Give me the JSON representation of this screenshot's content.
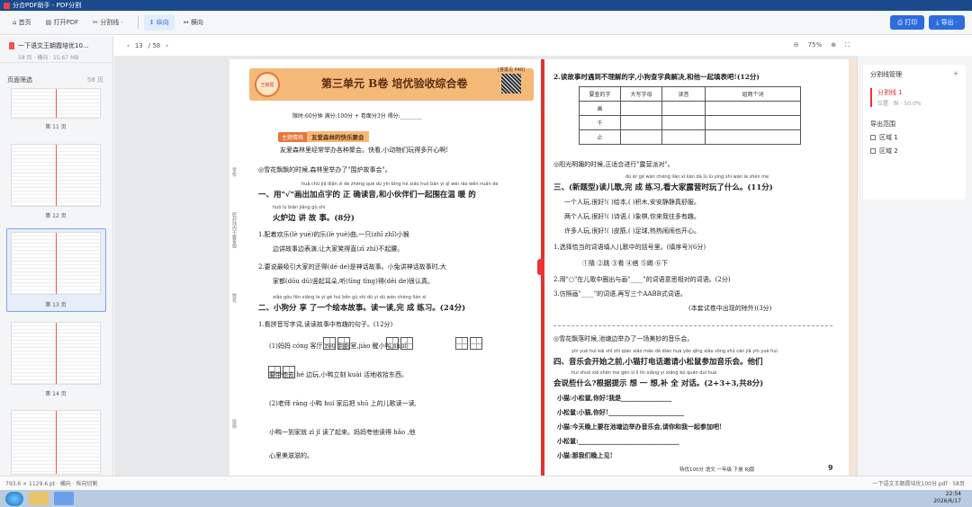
{
  "window": {
    "title": "分合PDF助手 - PDF分割"
  },
  "toolbar": {
    "home": "首页",
    "open_pdf": "打开PDF",
    "split_mode": "分割线 ·",
    "vertical": "纵向",
    "horizontal": "横向",
    "print": "打印",
    "export": "导出 ·"
  },
  "sidebar": {
    "file_name": "一下语文王朝霞培优10...",
    "file_meta": "58 页 · 横向 · 15.67 MB",
    "pages_title": "页面筛选",
    "pages_count": "58 页",
    "thumbs": [
      "第 11 页",
      "第 12 页",
      "第 13 页",
      "第 14 页",
      "第 15 页"
    ]
  },
  "pagebar": {
    "current": "13",
    "total": "/ 58",
    "zoom": "75%"
  },
  "paper": {
    "tag": "[答案见 P48]",
    "badge": "王朝霞",
    "title": "第三单元   B卷   培优验收综合卷",
    "qr_note": "扫码看视频·课题微",
    "timing": "限时:60分钟   满分:100分 + 卷面分3分   得分:________",
    "topic_tag": "主题情境",
    "topic": "友爱森林的快乐聚会",
    "intro": "友爱森林里经常举办各种聚会。快看,小动物们玩得多开心啊!",
    "intro2": "◎雪花飘飘的时候,森林里举办了\"围炉故事会\"。",
    "q1_py": "huà chū jiā diǎn zì   de   zhèng què dú yīn   bìng hé xiǎo huǒ bàn yì qǐ wéi rào wēn nuǎn de",
    "q1": "一、用\"√\"画出加点字的 正 确读音,和小伙伴们一起围在温 暖 的",
    "q1b_py": "huǒ lú biān jiǎng gù shi",
    "q1b": "火炉边 讲 故 事。(8分)",
    "q1_1": "1.配着欢乐(lè  yuè)的乐(lè  yuè)曲,一只(zhī  zhǐ)小猴",
    "q1_1b": "边讲故事边表演,让大家笑得直(zī  zhí)不起腰。",
    "q1_2": "2.要说最吸引大家的还得(dé  de)是神话故事。小兔讲神话故事时,大",
    "q1_2b": "家都(dōu  dū)竖起耳朵,听(tīng  tìng)得(děi  de)很认真。",
    "q2_py": "xiǎo gǒu fēn xiǎng le  yí gè huì běn gù shi   dú  yì dú   wán chéng liàn xí",
    "q2": "二、小狗分 享 了一个绘本故事。读一读,完 成 练习。(24分)",
    "q2_1": "1.看拼音写字词,读读故事中有趣的句子。(12分)",
    "q2_1a": "(1)妈妈 cóng       客厅 zǒu       到卧室,jiào       醒小鸭,shuō",
    "q2_1b": "       要带他去 hé       边玩,小鸭立刻 kuài       活地收拾东西。",
    "q2_1c": "(2)老师 ràng       小鸭 huí       家后把 shū       上的儿歌读一读,",
    "q2_1d": "小鸭一到家就 zì jǐ                   读了起来。妈妈夸他读得 hǎo       ,他",
    "q2_1e": "心里美滋滋的。",
    "side_name": "学校:",
    "side_class": "班级:",
    "side_seat": "姓名:",
    "side_note": "密封线内不要答题",
    "r_q2": "2.读故事时遇到不理解的字,小狗查字典解决,和他一起填表吧!(12分)",
    "table_head": [
      "要查的字",
      "大写字母",
      "读音",
      "组两个词"
    ],
    "table_rows": [
      "画",
      "千",
      "止"
    ],
    "r_intro": "◎阳光明媚的时候,正适合进行\"露营派对\"。",
    "r_q3_py": "dú ér gē   wán chéng liàn xí   kàn   dà  lù  lù  yíng shí  wán le  shén me",
    "r_q3": "三、(新题型)读儿歌,完 成 练习,看大家露营时玩了什么。(11分)",
    "poem": [
      "一个人玩,很好!(   )绘本,(   )积木,安安静静真舒服。",
      "两个人玩,很好!(   )诗语,(   )象棋,你来我往多有趣。",
      "许多人玩,很好!(   )皮筋,(   )足球,热热闹闹也开心。"
    ],
    "r_q3_1": "1.选择恰当的词语填入儿歌中的括号里。(填序号)(6分)",
    "options": "①猜      ②跳      ③看      ④搭      ⑤踢      ⑥下",
    "r_q3_2": "2.用\"○\"在儿歌中圈出与画\"____\"的词语意思相对的词语。(2分)",
    "r_q3_3": "3.仿照画\"____\"的词语,再写三个AABB式词语。",
    "r_q3_3b": "(本套试卷中出现的除外)(3分)",
    "r_intro2": "◎雪花飘落时候,池塘边举办了一场美妙的音乐会。",
    "r_q4_py": "yīn yuè huì kāi shǐ zhī qián   xiǎo māo dǎ diàn huà yāo qǐng xiǎo sōng shǔ cān jiā yīn yuè huì",
    "r_q4": "四、音乐会开始之前,小猫打电话邀请小松鼠参加音乐会。他们",
    "r_q4b_py": "huì shuō xiē shén me    gēn  sì  lì  lín xiǎng yi xiǎng    bǔ quán duì huà",
    "r_q4b": "会说些什么?根据提示 想 一 想,补 全 对话。(2+3+3,共8分)",
    "dialog": [
      "小猫:小松鼠,你好!我是________________",
      "小松鼠:小猫,你好!________________________",
      "小猫:今天晚上要在池塘边举办音乐会,请你和我一起参加吧!",
      "小松鼠:________________________________",
      "小猫:那我们晚上见!"
    ],
    "footer": "特优100分  语文   一年级   下册   RJ版",
    "page_no": "9"
  },
  "rpanel": {
    "title": "分割线管理",
    "line_name": "分割线 1",
    "line_meta": "位置 · 纵 · 50.0%",
    "region_title": "导出范围",
    "regions": [
      "区域 1",
      "区域 2"
    ]
  },
  "statusbar": {
    "left": "793.6 × 1129.6 pt · 横向 · 纵向切割",
    "right": "一下语文王朝霞培优100分.pdf · 58页"
  },
  "taskbar": {
    "time": "22:54",
    "date": "2026/6/17"
  },
  "colors": {
    "accent": "#2d6cdf",
    "cutline": "#dd3333",
    "banner": "#f4b977"
  }
}
